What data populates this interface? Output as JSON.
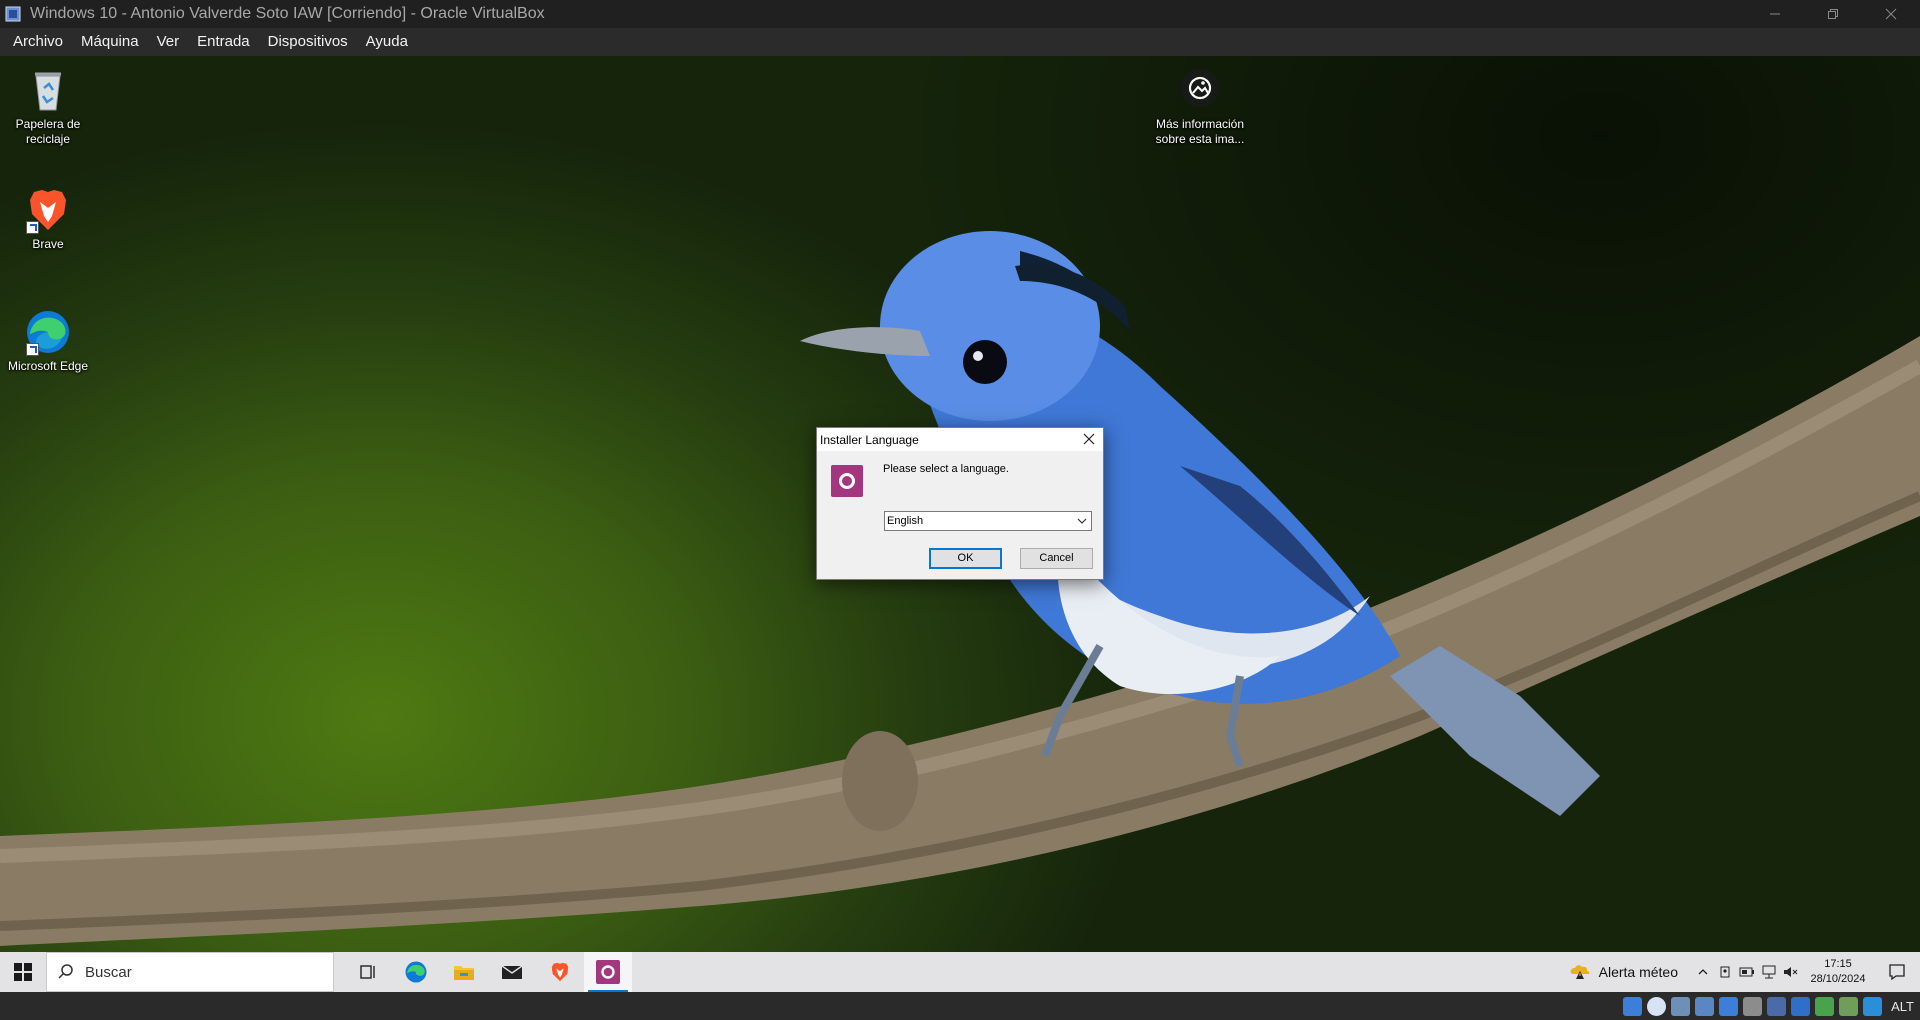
{
  "window": {
    "title": "Windows 10 - Antonio Valverde Soto IAW [Corriendo] - Oracle VirtualBox",
    "controls": [
      "minimize-icon",
      "restore-icon",
      "close-icon"
    ]
  },
  "menubar": {
    "items": [
      "Archivo",
      "Máquina",
      "Ver",
      "Entrada",
      "Dispositivos",
      "Ayuda"
    ]
  },
  "desktop": {
    "icons": [
      {
        "label_line1": "Papelera de",
        "label_line2": "reciclaje",
        "icon": "recycle-bin-icon"
      },
      {
        "label_line1": "Brave",
        "label_line2": "",
        "icon": "brave-icon"
      },
      {
        "label_line1": "Microsoft Edge",
        "label_line2": "",
        "icon": "edge-icon"
      },
      {
        "label_line1": "Más información",
        "label_line2": "sobre esta ima...",
        "icon": "camera-info-icon"
      }
    ]
  },
  "dialog": {
    "title": "Installer Language",
    "prompt": "Please select a language.",
    "selected_language": "English",
    "ok_label": "OK",
    "cancel_label": "Cancel"
  },
  "taskbar": {
    "search_placeholder": "Buscar",
    "apps": [
      "task-view-icon",
      "edge-icon",
      "file-explorer-icon",
      "mail-icon",
      "brave-icon",
      "installer-icon"
    ],
    "weather": "Alerta méteo",
    "time": "17:15",
    "date": "28/10/2024"
  },
  "statusbar": {
    "host_key": "ALT"
  },
  "colors": {
    "accent": "#0078d7",
    "installer": "#a2367f",
    "brave": "#fb542b"
  }
}
